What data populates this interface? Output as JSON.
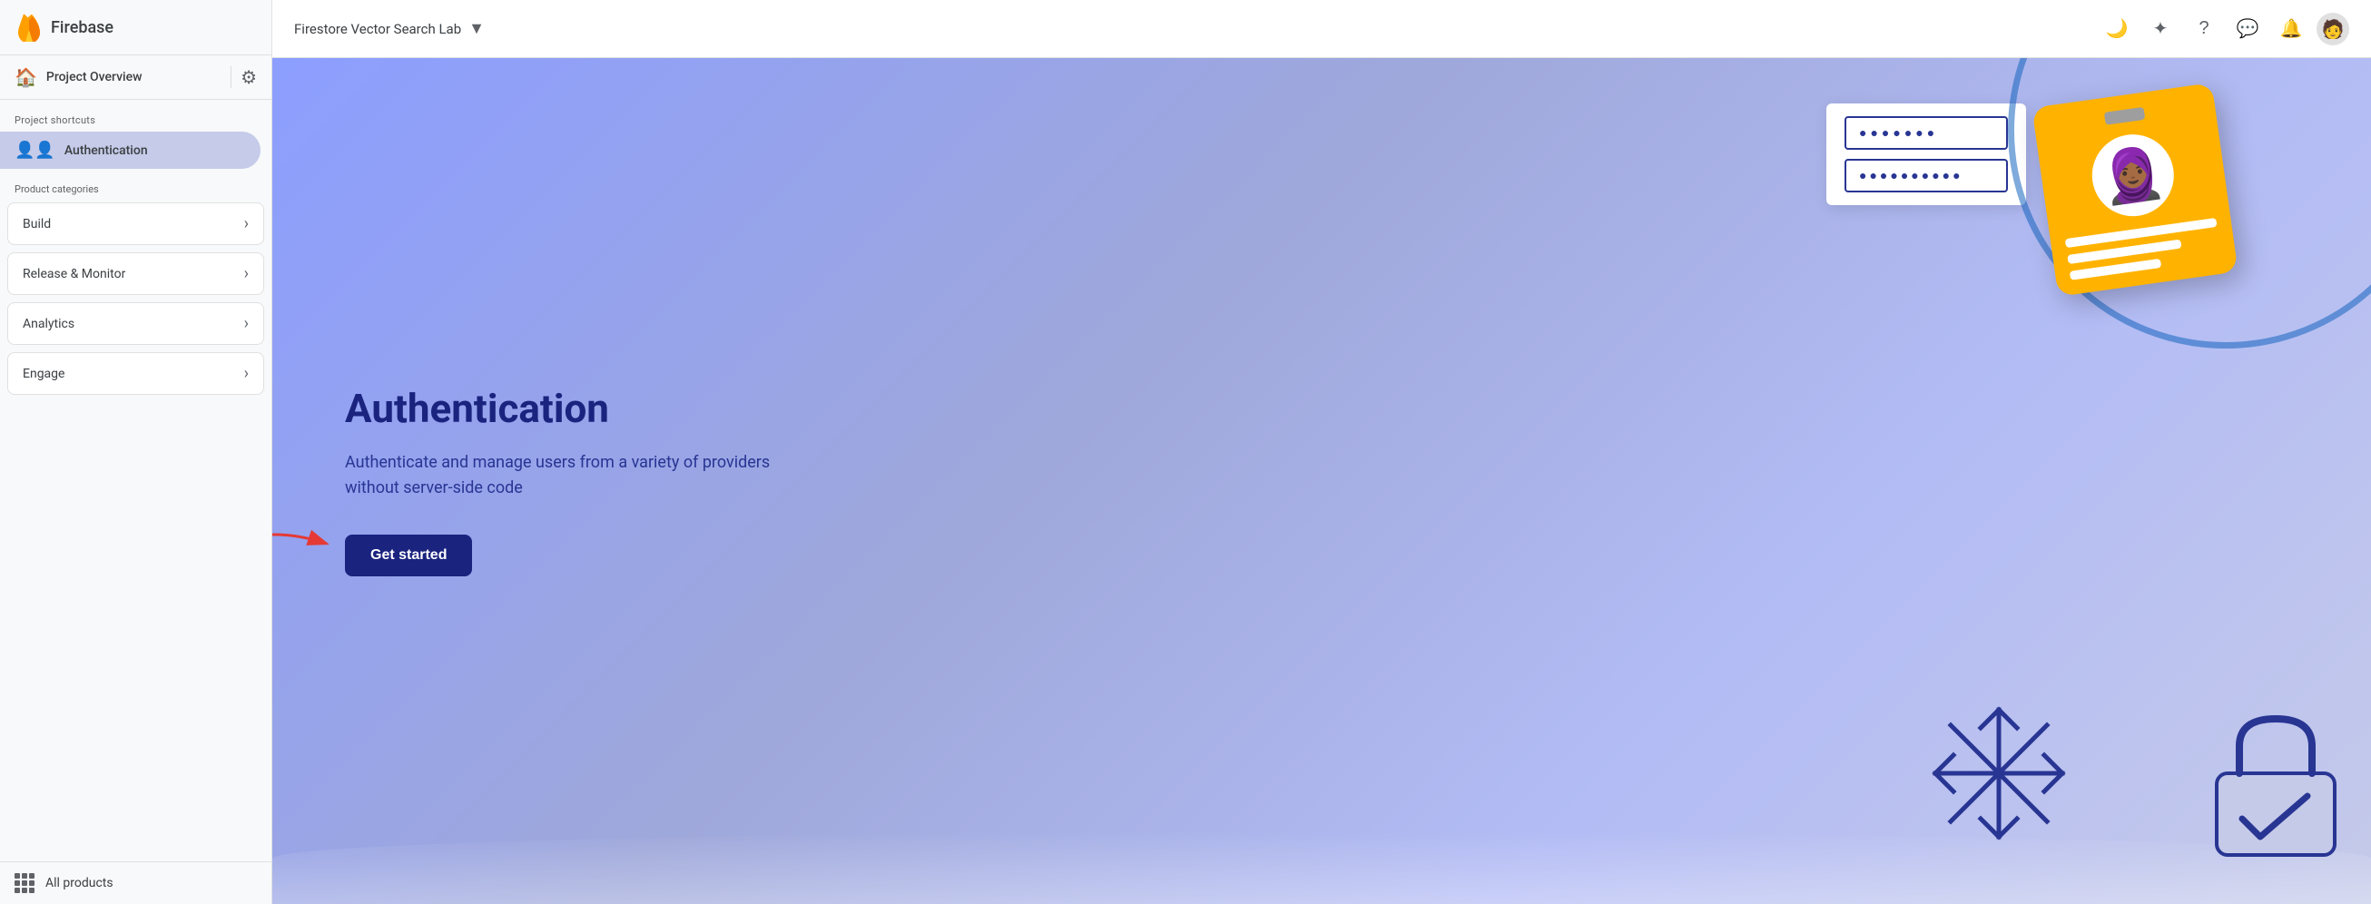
{
  "app": {
    "name": "Firebase"
  },
  "header": {
    "project_name": "Firestore Vector Search Lab",
    "dropdown_arrow": "▼"
  },
  "sidebar": {
    "project_overview": "Project Overview",
    "project_shortcuts_label": "Project shortcuts",
    "auth_item": "Authentication",
    "product_categories_label": "Product categories",
    "categories": [
      {
        "label": "Build"
      },
      {
        "label": "Release & Monitor"
      },
      {
        "label": "Analytics"
      },
      {
        "label": "Engage"
      }
    ],
    "all_products": "All products"
  },
  "hero": {
    "title": "Authentication",
    "description": "Authenticate and manage users from a variety of providers without server-side code",
    "cta_label": "Get started"
  },
  "topbar_icons": {
    "dark_mode": "🌙",
    "spark": "✦",
    "help": "?",
    "chat": "💬",
    "notifications": "🔔"
  },
  "input_mock": {
    "dots1": "●●●●●●●",
    "dots2": "●●●●●●●●●●"
  }
}
